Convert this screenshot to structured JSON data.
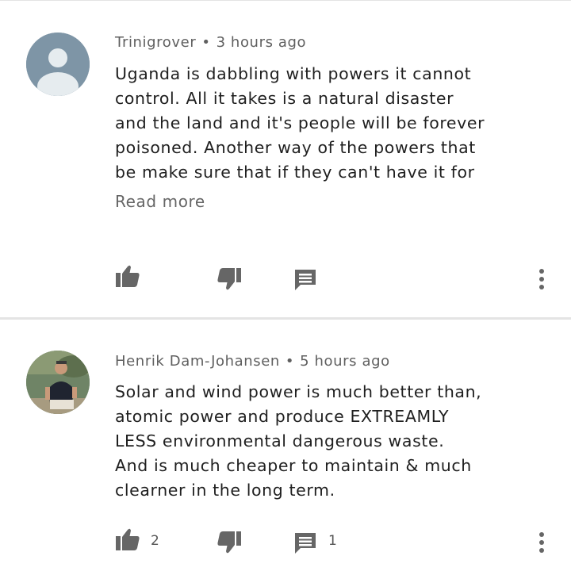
{
  "comments": [
    {
      "author": "Trinigrover",
      "time": "3 hours ago",
      "lines": [
        "Uganda is dabbling with powers it cannot",
        "control. All it takes is a natural disaster",
        "and the land and it's people will be forever",
        "poisoned. Another way of the powers that",
        "be make sure that if they can't have it for"
      ],
      "read_more": "Read more",
      "likes": "",
      "replies": ""
    },
    {
      "author": "Henrik Dam-Johansen",
      "time": "5 hours ago",
      "lines": [
        "Solar and wind power is much better than,",
        "atomic power and produce EXTREAMLY",
        "LESS environmental  dangerous waste.",
        "And is much cheaper to maintain & much",
        "clearner in the long term."
      ],
      "likes": "2",
      "replies": "1"
    }
  ],
  "separator": "•",
  "icons": {
    "like": "thumb-up-icon",
    "dislike": "thumb-down-icon",
    "reply": "comment-icon",
    "more": "more-vert-icon"
  },
  "colors": {
    "icon": "#666666",
    "avatar_default": "#7e95a6",
    "divider": "#e4e4e4"
  }
}
